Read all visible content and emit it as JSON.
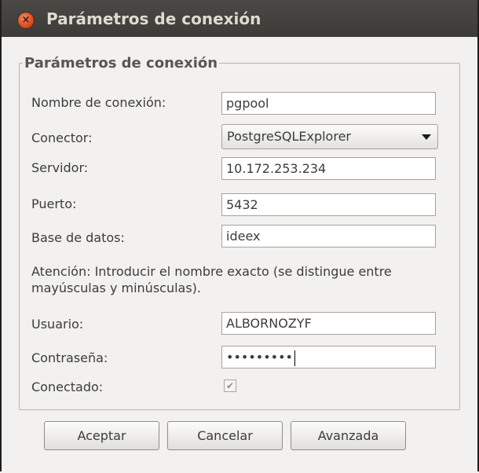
{
  "window": {
    "title": "Parámetros de conexión",
    "close_glyph": "×"
  },
  "group": {
    "title": "Parámetros de conexión"
  },
  "fields": {
    "connection_name": {
      "label": "Nombre de conexión:",
      "value": "pgpool"
    },
    "connector": {
      "label": "Conector:",
      "value": "PostgreSQLExplorer"
    },
    "server": {
      "label": "Servidor:",
      "value": "10.172.253.234"
    },
    "port": {
      "label": "Puerto:",
      "value": "5432"
    },
    "database": {
      "label": "Base de datos:",
      "value": "ideex"
    },
    "user": {
      "label": "Usuario:",
      "value": "ALBORNOZYF"
    },
    "password": {
      "label": "Contraseña:",
      "value": "•••••••••"
    },
    "connected": {
      "label": "Conectado:",
      "checked": true,
      "check_glyph": "✔"
    }
  },
  "note": "Atención: Introducir el nombre exacto (se distingue entre mayúsculas y minúsculas).",
  "buttons": {
    "accept": "Aceptar",
    "cancel": "Cancelar",
    "advanced": "Avanzada"
  },
  "icons": {
    "close": "close-icon",
    "dropdown": "chevron-down-icon",
    "check": "checkmark-icon"
  }
}
